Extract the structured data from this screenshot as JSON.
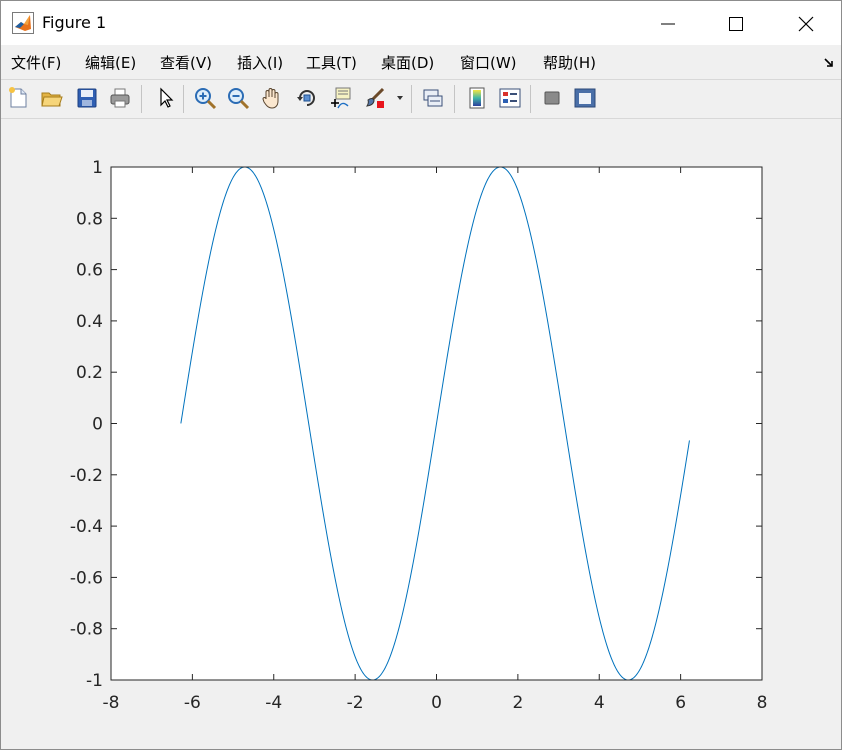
{
  "window": {
    "title": "Figure 1",
    "controls": [
      "minimize",
      "maximize",
      "close"
    ]
  },
  "menu": {
    "items": [
      {
        "label": "文件(F)",
        "name": "file"
      },
      {
        "label": "编辑(E)",
        "name": "edit"
      },
      {
        "label": "查看(V)",
        "name": "view"
      },
      {
        "label": "插入(I)",
        "name": "insert"
      },
      {
        "label": "工具(T)",
        "name": "tools"
      },
      {
        "label": "桌面(D)",
        "name": "desktop"
      },
      {
        "label": "窗口(W)",
        "name": "window"
      },
      {
        "label": "帮助(H)",
        "name": "help"
      }
    ]
  },
  "toolbar": {
    "buttons": [
      "new-figure-icon",
      "open-file-icon",
      "save-icon",
      "print-icon",
      "edit-plot-arrow-icon",
      "zoom-in-icon",
      "zoom-out-icon",
      "pan-hand-icon",
      "rotate-3d-icon",
      "data-cursor-icon",
      "brush-icon",
      "link-plot-icon",
      "insert-colorbar-icon",
      "insert-legend-icon",
      "hide-plot-tools-icon",
      "show-plot-tools-icon"
    ]
  },
  "colors": {
    "line": "#0072bd",
    "axes_bg": "#ffffff",
    "figure_bg": "#f0f0f0",
    "tick_text": "#262626"
  },
  "chart_data": {
    "type": "line",
    "title": "",
    "xlabel": "",
    "ylabel": "",
    "xlim": [
      -8,
      8
    ],
    "ylim": [
      -1,
      1
    ],
    "xticks": [
      "-8",
      "-6",
      "-4",
      "-2",
      "0",
      "2",
      "4",
      "6",
      "8"
    ],
    "yticks": [
      "1",
      "0.8",
      "0.6",
      "0.4",
      "0.2",
      "0",
      "-0.2",
      "-0.4",
      "-0.6",
      "-0.8",
      "-1"
    ],
    "grid": false,
    "function": "sin(x)",
    "x_range": [
      -6.283,
      6.217
    ],
    "x_step": 0.1,
    "series": [
      {
        "x": [
          -6.283,
          -5.283,
          -4.712,
          -4.283,
          -3.283,
          -2.283,
          -1.571,
          -1.283,
          -0.283,
          0.0,
          0.717,
          1.571,
          2.717,
          3.717,
          4.712,
          5.717,
          6.217
        ],
        "y": [
          0.0,
          0.841,
          1.0,
          0.909,
          0.141,
          -0.757,
          -1.0,
          -0.959,
          -0.279,
          0.0,
          0.657,
          1.0,
          0.412,
          -0.544,
          -1.0,
          -0.537,
          -0.066
        ]
      }
    ]
  }
}
